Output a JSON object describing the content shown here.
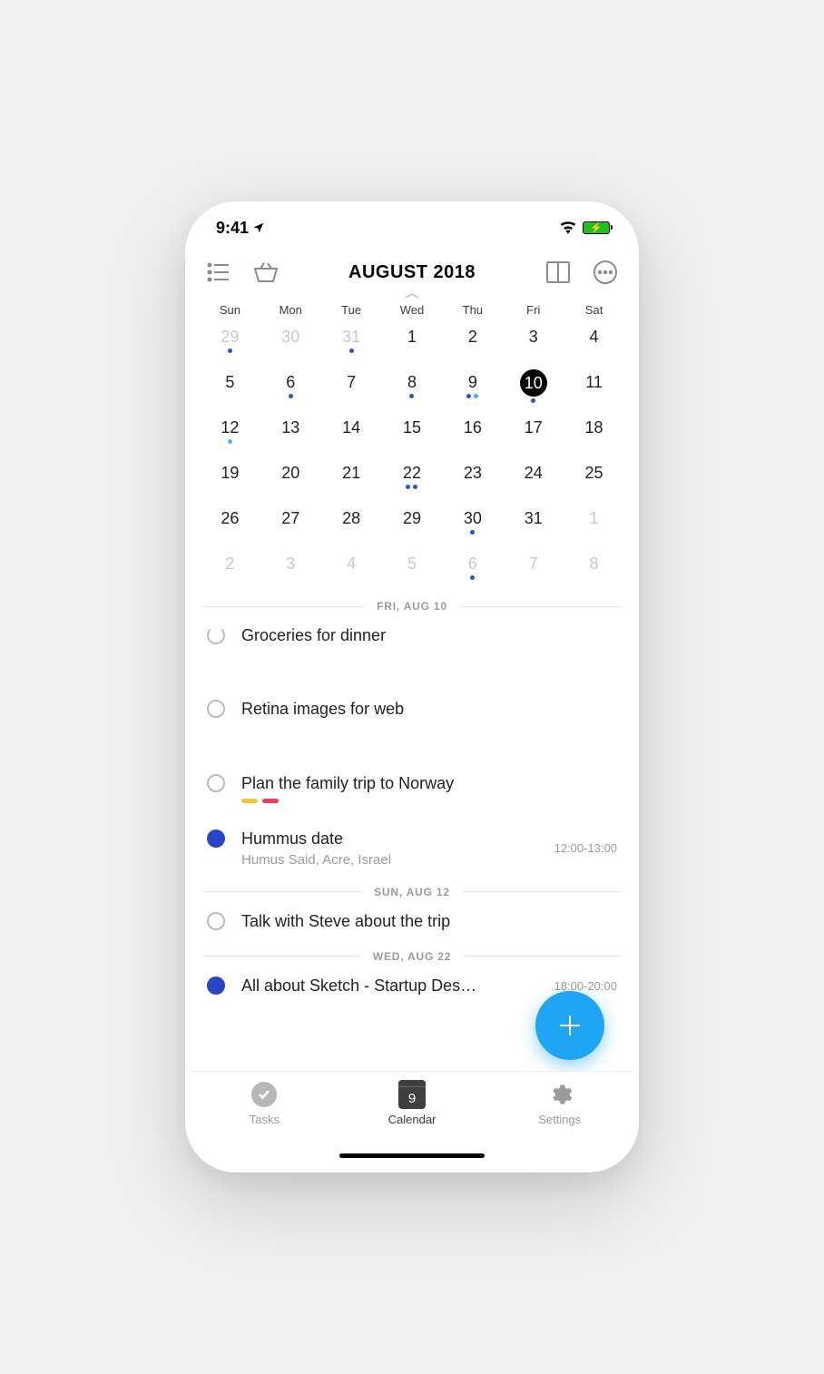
{
  "status": {
    "time": "9:41"
  },
  "header": {
    "title": "AUGUST 2018"
  },
  "weekdays": [
    "Sun",
    "Mon",
    "Tue",
    "Wed",
    "Thu",
    "Fri",
    "Sat"
  ],
  "calendar": [
    {
      "n": "29",
      "dim": true,
      "dots": [
        "blue"
      ]
    },
    {
      "n": "30",
      "dim": true
    },
    {
      "n": "31",
      "dim": true,
      "dots": [
        "blue"
      ]
    },
    {
      "n": "1"
    },
    {
      "n": "2"
    },
    {
      "n": "3"
    },
    {
      "n": "4"
    },
    {
      "n": "5"
    },
    {
      "n": "6",
      "dots": [
        "blue"
      ]
    },
    {
      "n": "7"
    },
    {
      "n": "8",
      "dots": [
        "blue"
      ]
    },
    {
      "n": "9",
      "dots": [
        "blue",
        "light"
      ]
    },
    {
      "n": "10",
      "selected": true,
      "dots": [
        "blue"
      ]
    },
    {
      "n": "11"
    },
    {
      "n": "12",
      "dots": [
        "light"
      ]
    },
    {
      "n": "13"
    },
    {
      "n": "14"
    },
    {
      "n": "15"
    },
    {
      "n": "16"
    },
    {
      "n": "17"
    },
    {
      "n": "18"
    },
    {
      "n": "19"
    },
    {
      "n": "20"
    },
    {
      "n": "21"
    },
    {
      "n": "22",
      "dots": [
        "blue",
        "blue"
      ]
    },
    {
      "n": "23"
    },
    {
      "n": "24"
    },
    {
      "n": "25"
    },
    {
      "n": "26"
    },
    {
      "n": "27"
    },
    {
      "n": "28"
    },
    {
      "n": "29"
    },
    {
      "n": "30",
      "dots": [
        "blue"
      ]
    },
    {
      "n": "31"
    },
    {
      "n": "1",
      "dim": true
    },
    {
      "n": "2",
      "dim": true
    },
    {
      "n": "3",
      "dim": true
    },
    {
      "n": "4",
      "dim": true
    },
    {
      "n": "5",
      "dim": true
    },
    {
      "n": "6",
      "dim": true,
      "dots": [
        "blue"
      ]
    },
    {
      "n": "7",
      "dim": true
    },
    {
      "n": "8",
      "dim": true
    }
  ],
  "sections": {
    "s1": "FRI, AUG 10",
    "s2": "SUN, AUG 12",
    "s3": "WED, AUG 22"
  },
  "tasks": {
    "t1": "Groceries for dinner",
    "t2": "Retina images for web",
    "t3": "Plan the family trip to Norway",
    "t4": {
      "title": "Hummus date",
      "sub": "Humus Said, Acre, Israel",
      "time": "12:00-13:00"
    },
    "t5": "Talk with Steve about the trip",
    "t6": {
      "title": "All about Sketch - Startup Des…",
      "time": "18:00-20:00"
    }
  },
  "tabs": {
    "tasks": "Tasks",
    "calendar": "Calendar",
    "settings": "Settings",
    "calnum": "9"
  }
}
